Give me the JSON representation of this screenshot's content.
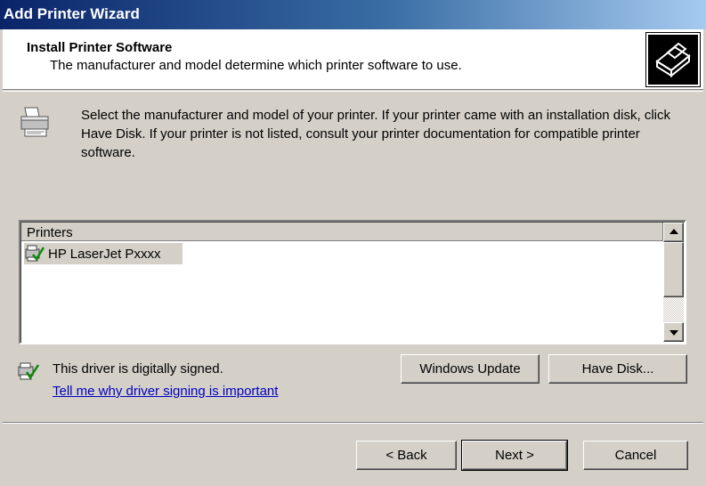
{
  "window": {
    "title": "Add Printer Wizard"
  },
  "header": {
    "title": "Install Printer Software",
    "subtitle": "The manufacturer and model determine which printer software to use.",
    "icon": "printer-wizard-icon"
  },
  "intro": {
    "icon": "printer-icon",
    "text": "Select the manufacturer and model of your printer. If your printer came with an installation disk, click Have Disk. If your printer is not listed, consult your printer documentation for compatible printer software."
  },
  "printers_list": {
    "column_header": "Printers",
    "items": [
      {
        "label": "HP LaserJet Pxxxx",
        "icon": "signed-driver-icon",
        "selected": true
      }
    ]
  },
  "driver_status": {
    "icon": "signed-driver-icon",
    "text": "This driver is digitally signed.",
    "link": "Tell me why driver signing is important"
  },
  "buttons": {
    "windows_update": "Windows Update",
    "have_disk": "Have Disk...",
    "back": "< Back",
    "next": "Next >",
    "cancel": "Cancel"
  },
  "colors": {
    "title_bar": "#0a246a",
    "face": "#d4d0c8",
    "link": "#0000c0"
  }
}
